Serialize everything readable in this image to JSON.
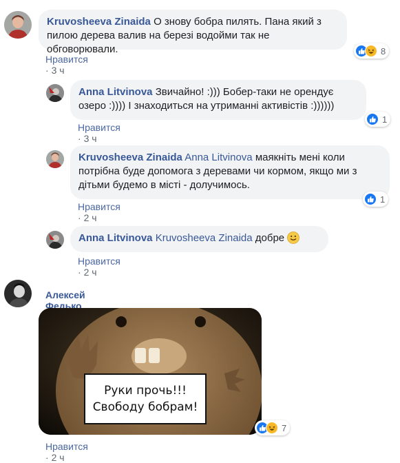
{
  "colors": {
    "link_blue": "#385898",
    "bubble_bg": "#f2f3f5",
    "meta_gray": "#606770",
    "like_blue": "#1877f2",
    "haha_yellow": "#f7b928"
  },
  "comments": [
    {
      "author": "Kruvosheeva Zinaida",
      "text": "О знову бобра пилять. Пана який з пилою дерева валив на березі водойми так не обговорювали.",
      "like_label": "Нравится",
      "time": "3 ч",
      "reactions": {
        "icons": [
          "like-icon",
          "haha-icon"
        ],
        "count": "8"
      }
    },
    {
      "author": "Anna Litvinova",
      "text": "Звичайно! :))) Бобер-таки не орендує озеро :)))) І знаходиться на утриманні активістів :))))))",
      "like_label": "Нравится",
      "time": "3 ч",
      "reactions": {
        "icons": [
          "like-icon"
        ],
        "count": "1"
      }
    },
    {
      "author": "Kruvosheeva Zinaida",
      "mention": "Anna Litvinova",
      "text": "маякніть мені коли потрібна буде допомога з деревами чи кормом, якщо ми з дітьми будемо в місті - долучимось.",
      "like_label": "Нравится",
      "time": "2 ч",
      "reactions": {
        "icons": [
          "like-icon"
        ],
        "count": "1"
      }
    },
    {
      "author": "Anna Litvinova",
      "mention": "Kruvosheeva Zinaida",
      "text": "добре",
      "emoji": "slightly-smiling-face-icon",
      "like_label": "Нравится",
      "time": "2 ч"
    },
    {
      "author": "Алексей Федько",
      "image_caption_line1": "Руки прочь!!!",
      "image_caption_line2": "Свободу бобрам!",
      "like_label": "Нравится",
      "time": "2 ч",
      "reactions": {
        "icons": [
          "like-icon",
          "haha-icon"
        ],
        "count": "7"
      }
    }
  ]
}
